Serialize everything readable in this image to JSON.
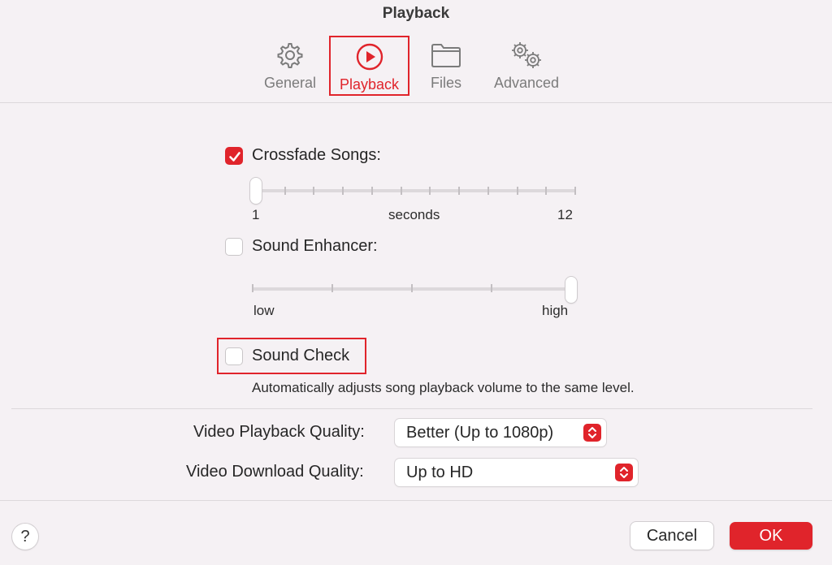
{
  "window": {
    "title": "Playback"
  },
  "tabs": [
    {
      "label": "General",
      "icon": "gear-icon"
    },
    {
      "label": "Playback",
      "icon": "play-circle-icon",
      "selected": true
    },
    {
      "label": "Files",
      "icon": "folder-icon"
    },
    {
      "label": "Advanced",
      "icon": "gears-icon"
    }
  ],
  "crossfade": {
    "label": "Crossfade Songs:",
    "checked": true,
    "slider_min_label": "1",
    "slider_unit_label": "seconds",
    "slider_max_label": "12",
    "value_seconds": 1
  },
  "sound_enhancer": {
    "label": "Sound Enhancer:",
    "checked": false,
    "slider_min_label": "low",
    "slider_max_label": "high",
    "level_fraction": 1.0
  },
  "sound_check": {
    "label": "Sound Check",
    "checked": false,
    "description": "Automatically adjusts song playback volume to the same level."
  },
  "video": {
    "playback_quality_label": "Video Playback Quality:",
    "playback_quality_value": "Better (Up to 1080p)",
    "download_quality_label": "Video Download Quality:",
    "download_quality_value": "Up to HD"
  },
  "footer": {
    "help_label": "?",
    "cancel_label": "Cancel",
    "ok_label": "OK"
  },
  "colors": {
    "accent": "#e0242b",
    "background": "#f5f1f4"
  }
}
